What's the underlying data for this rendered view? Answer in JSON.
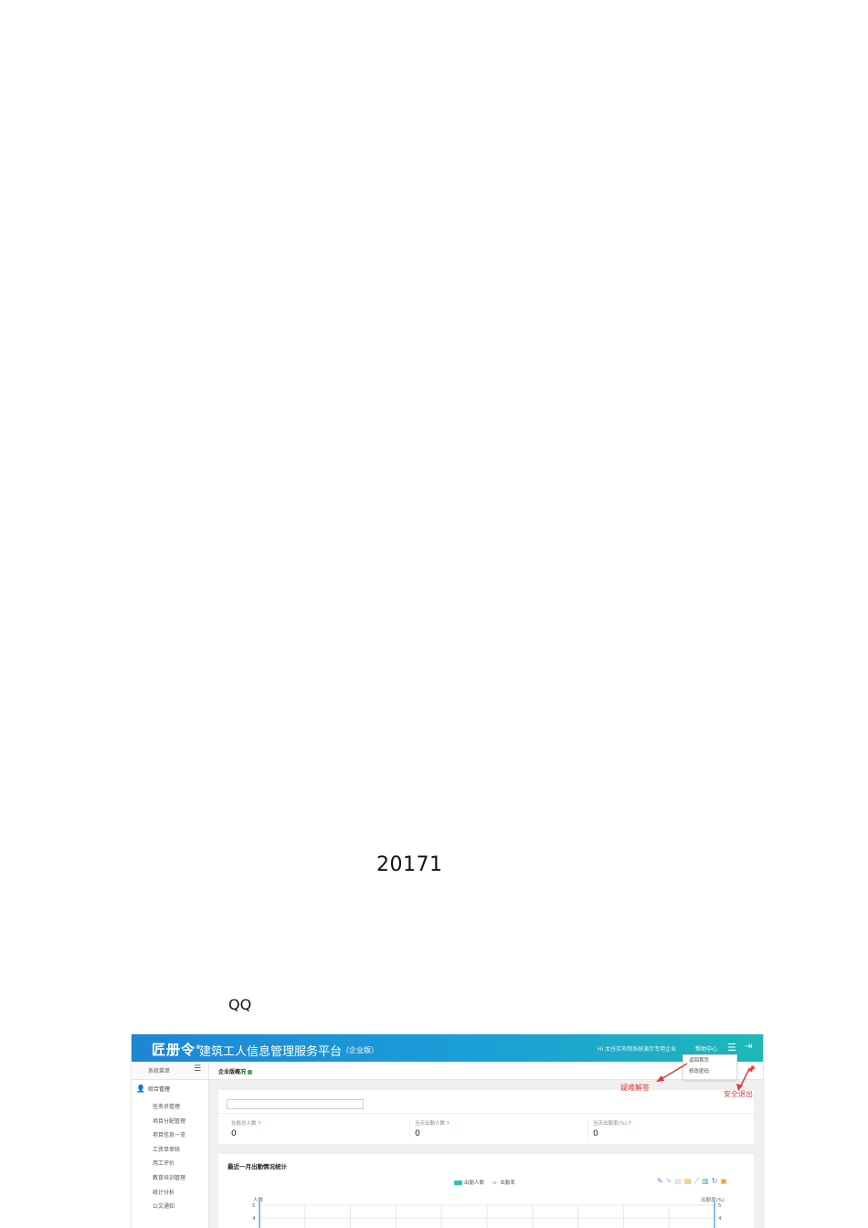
{
  "document": {
    "year_text": "20171",
    "qq_text": "QQ"
  },
  "app": {
    "logo": "匠册令",
    "platform_title": "建筑工人信息管理服务平台",
    "edition": "（企业版）",
    "company": "Hi 太仓实名制系统演示专用企业",
    "help_center": "帮助中心",
    "menu_icon": "menu-icon",
    "logout_icon": "logout-icon",
    "dropdown": [
      "返回首页",
      "修改密码"
    ]
  },
  "sidebar": {
    "title": "系统菜单",
    "group": "综合管理",
    "items": [
      "任务员管理",
      "项目分配管理",
      "项目信息一览",
      "工资单审核",
      "用工评价",
      "教育培训管理",
      "统计分析",
      "公文通知"
    ]
  },
  "tab": {
    "title": "企业版概况"
  },
  "annotations": {
    "help": "疑难解答",
    "exit": "安全退出"
  },
  "stats": [
    {
      "label": "在册总人数",
      "value": "0"
    },
    {
      "label": "当天出勤人数",
      "value": "0"
    },
    {
      "label": "当天出勤率(%)",
      "value": "0"
    }
  ],
  "chart_section": {
    "title": "最近一月出勤情况统计",
    "legend_bar": "出勤人数",
    "legend_line": "出勤率",
    "y_left_label": "人数",
    "y_right_label": "出勤率(%)"
  },
  "chart_data": {
    "type": "bar",
    "title": "最近一月出勤情况统计",
    "series": [
      {
        "name": "出勤人数",
        "values": []
      },
      {
        "name": "出勤率",
        "values": []
      }
    ],
    "ylabel": "人数",
    "y2label": "出勤率(%)",
    "y_ticks": [
      "5",
      "4"
    ],
    "y2_ticks": [
      "5",
      "4"
    ],
    "grid": true
  }
}
